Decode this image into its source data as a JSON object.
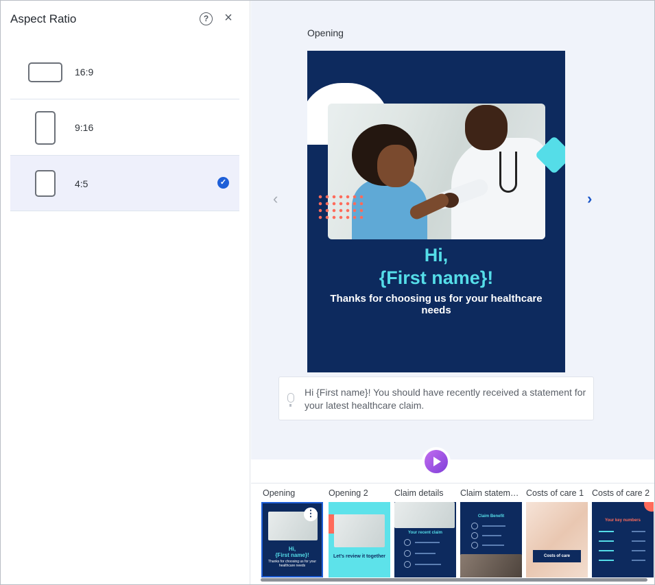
{
  "panel": {
    "title": "Aspect Ratio",
    "help_icon": "?",
    "close_icon": "×",
    "options": [
      {
        "label": "16:9",
        "selected": false
      },
      {
        "label": "9:16",
        "selected": false
      },
      {
        "label": "4:5",
        "selected": true
      }
    ]
  },
  "preview": {
    "title": "Opening",
    "slide": {
      "greeting": "Hi,",
      "name": "{First name}!",
      "subtitle": "Thanks for choosing us for your healthcare needs"
    },
    "script": "Hi {First name}! You should have recently received a statement for your latest healthcare claim."
  },
  "filmstrip": {
    "thumbnails": [
      {
        "label": "Opening",
        "active": true,
        "hi": "Hi,",
        "name": "{First name}!",
        "sub": "Thanks for choosing us for your healthcare needs"
      },
      {
        "label": "Opening 2",
        "active": false,
        "caption": "Let's review it together"
      },
      {
        "label": "Claim details",
        "active": false,
        "caption": "Your recent claim"
      },
      {
        "label": "Claim statem…",
        "active": false,
        "caption": "Claim Benefit"
      },
      {
        "label": "Costs of care 1",
        "active": false,
        "caption": "Costs of care"
      },
      {
        "label": "Costs of care 2",
        "active": false,
        "caption": "Your key numbers"
      }
    ]
  },
  "colors": {
    "slide_bg": "#0d2a5e",
    "accent_cyan": "#55dde8",
    "selected_bg": "#eef0fb",
    "check_blue": "#1e5fd8",
    "play_purple": "#9b4fe3"
  }
}
